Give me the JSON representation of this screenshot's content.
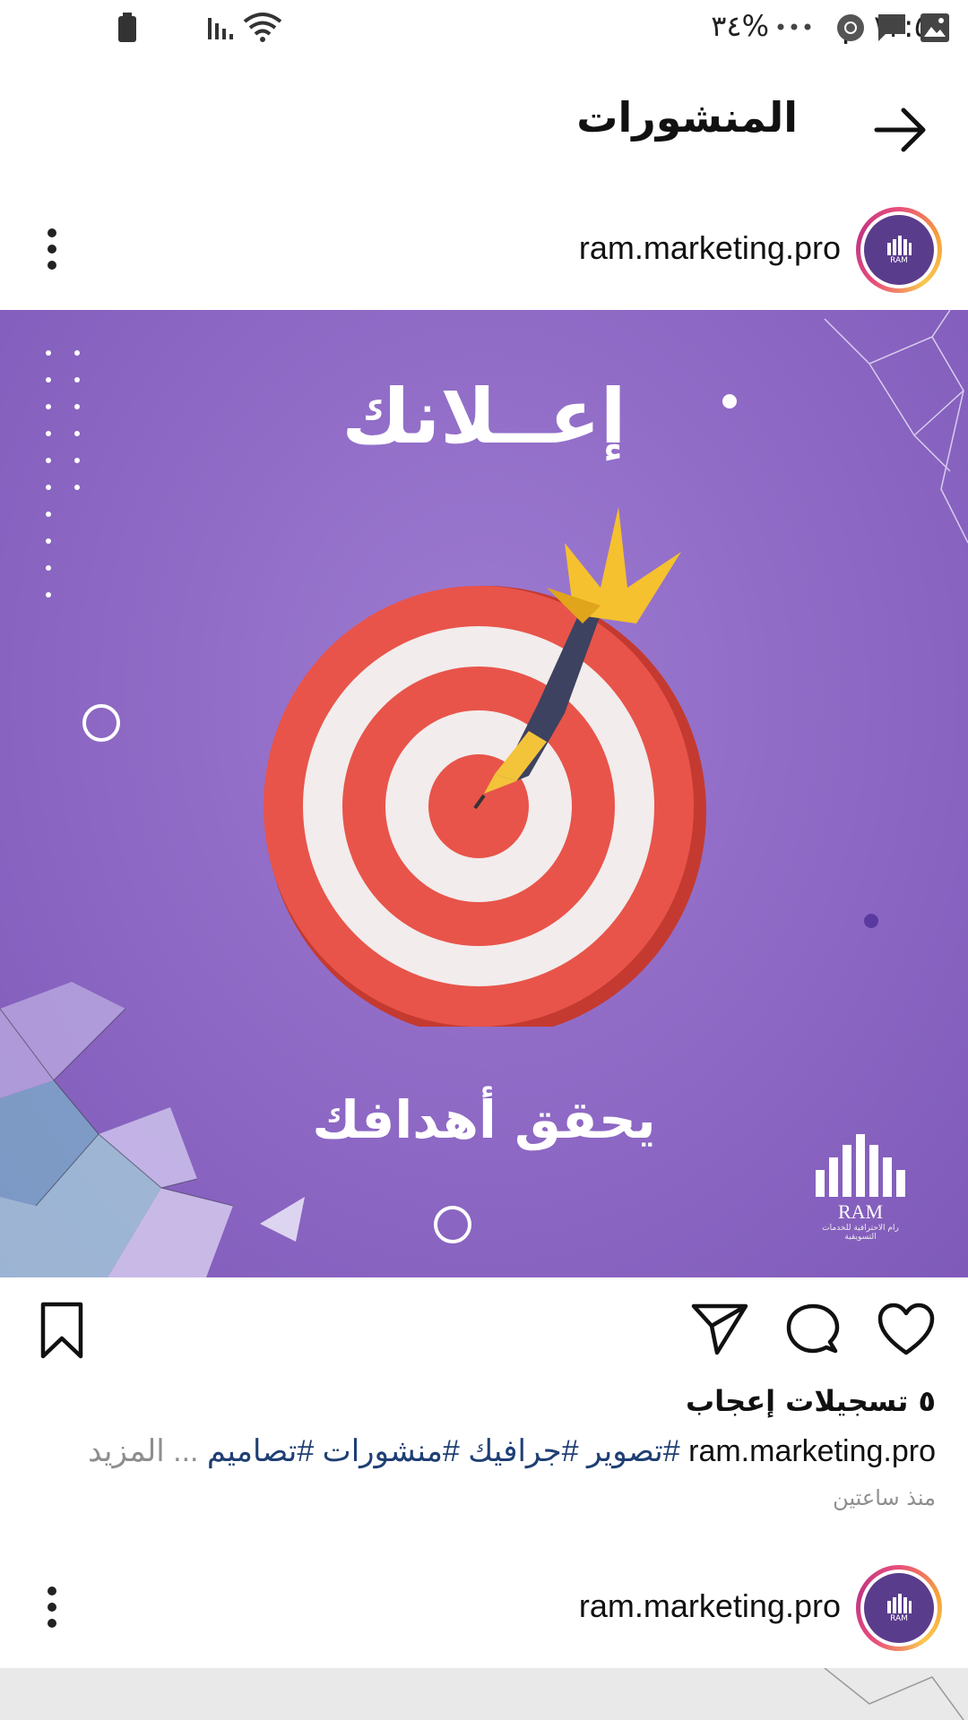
{
  "status_bar": {
    "time": "١٢:٥٣ م",
    "battery": "%٣٤",
    "icons": [
      "wifi-icon",
      "signal-icon",
      "battery-icon",
      "gallery-icon",
      "message-icon",
      "chrome-icon",
      "more-dots-icon"
    ]
  },
  "header": {
    "title": "المنشورات",
    "back_icon": "arrow-right-icon"
  },
  "post": {
    "username": "ram.marketing.pro",
    "avatar_label": "RAM",
    "image": {
      "headline": "إعــلانك",
      "subline": "يحقق أهدافك",
      "brand_name": "RAM",
      "brand_tagline": "رام الاحترافية للخدمات التسويقية"
    },
    "likes": "٥ تسجيلات إعجاب",
    "caption_user": "ram.marketing.pro",
    "caption_tags": "#تصوير #جرافيك #منشورات #تصاميم",
    "caption_more": "... المزيد",
    "timestamp": "منذ ساعتين"
  },
  "next_post": {
    "username": "ram.marketing.pro",
    "avatar_label": "RAM"
  }
}
